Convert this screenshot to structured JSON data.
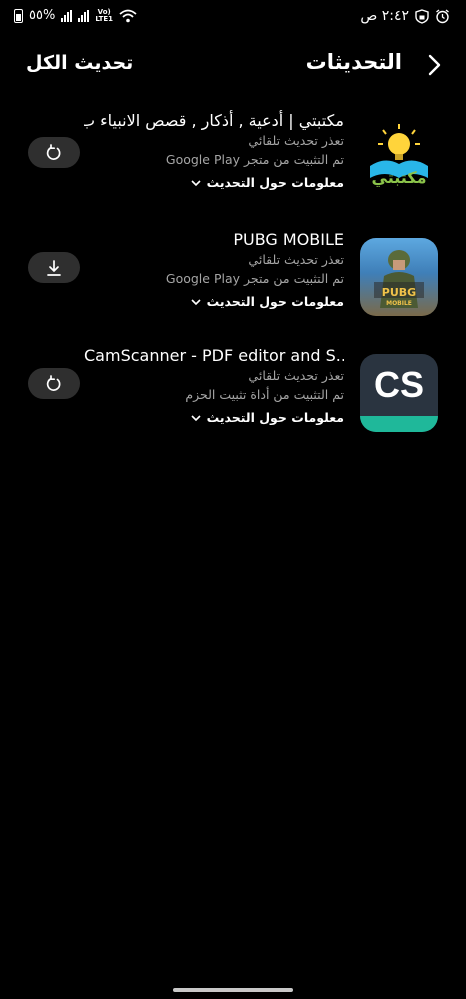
{
  "status_bar": {
    "battery_percent": "٥٥%",
    "network_label_top": "Vo)",
    "network_label_bottom": "LTE1",
    "time": "٢:٤٢ ص"
  },
  "header": {
    "title": "التحديثات",
    "update_all_label": "تحديث الكل",
    "back_icon": "chevron-right-icon"
  },
  "apps": [
    {
      "name": "مكتبتي | أدعية , أذكار , قصص الانبياء ب..",
      "status": "تعذر تحديث تلقائي",
      "source": "تم التثبيت من متجر Google Play",
      "info_label": "معلومات حول التحديث",
      "action": "retry",
      "icon_text": "مكتبتي"
    },
    {
      "name": "PUBG MOBILE",
      "status": "تعذر تحديث تلقائي",
      "source": "تم التثبيت من متجر Google Play",
      "info_label": "معلومات حول التحديث",
      "action": "download",
      "icon_text": "PUBG",
      "icon_subtext": "MOBILE"
    },
    {
      "name": "CamScanner - PDF editor and S...",
      "status": "تعذر تحديث تلقائي",
      "source": "تم التثبيت من أداة تثبيت الحزم",
      "info_label": "معلومات حول التحديث",
      "action": "retry",
      "icon_text": "CS"
    }
  ],
  "colors": {
    "background": "#000000",
    "secondary_text": "#a5a5a5",
    "button_bg": "#2f2f2f",
    "camscanner_green": "#1fb89a",
    "camscanner_dark": "#2a3440"
  }
}
